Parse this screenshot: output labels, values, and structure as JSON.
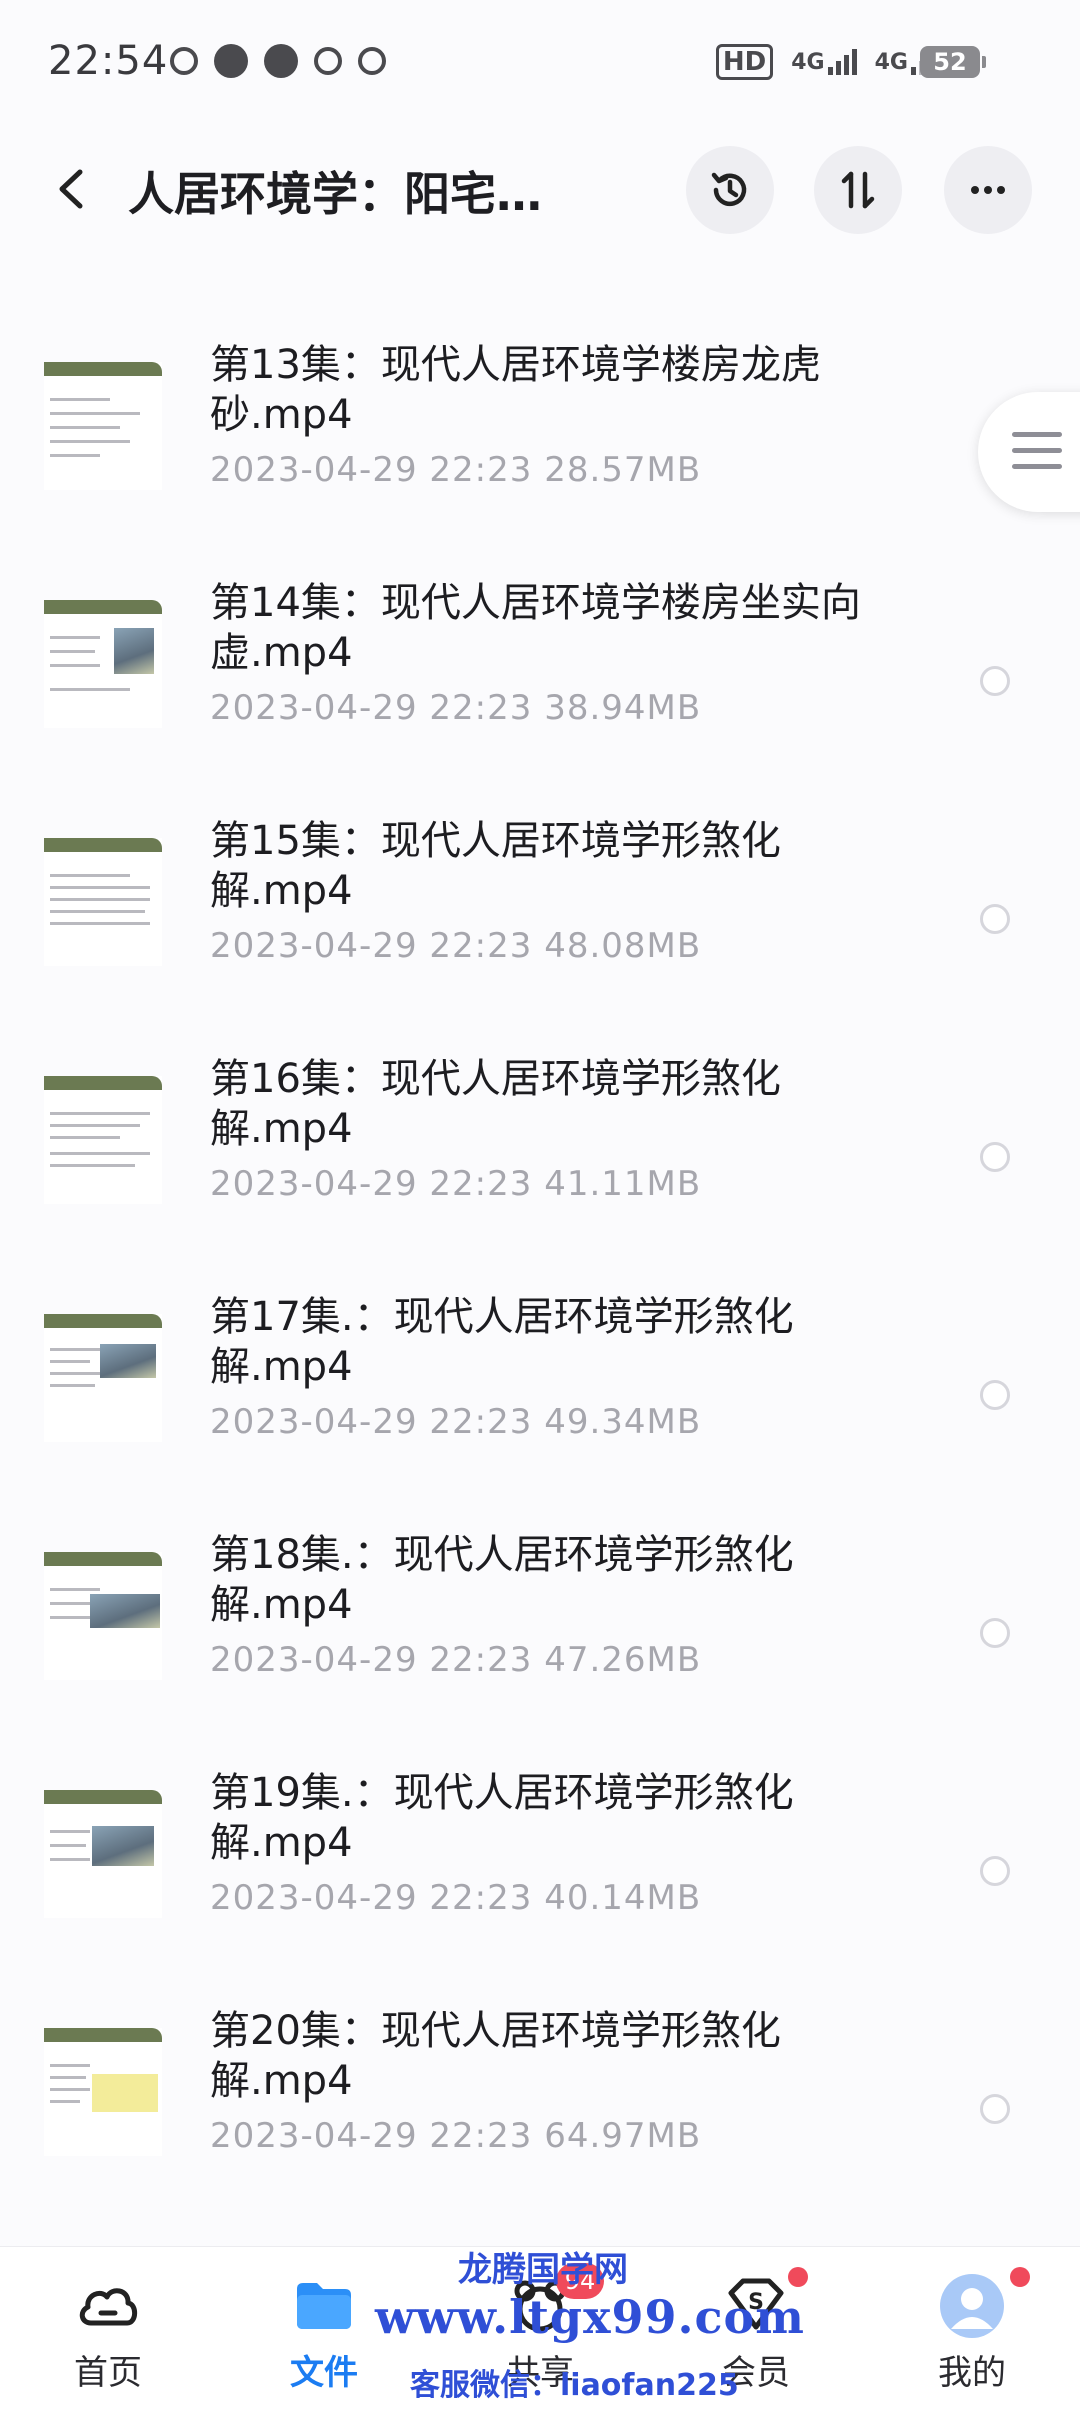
{
  "status_bar": {
    "time": "22:54",
    "hd_label": "HD",
    "net1": "4G",
    "net2": "4G",
    "battery": "52"
  },
  "header": {
    "title": "人居环境学：阳宅…",
    "back_icon": "chevron-left-icon",
    "history_icon": "history-icon",
    "sort_icon": "sort-icon",
    "more_icon": "more-icon"
  },
  "files": [
    {
      "name": "第13集：现代人居环境学楼房龙虎砂.mp4",
      "date": "2023-04-29",
      "time": "22:23",
      "size": "28.57MB"
    },
    {
      "name": "第14集：现代人居环境学楼房坐实向虚.mp4",
      "date": "2023-04-29",
      "time": "22:23",
      "size": "38.94MB"
    },
    {
      "name": "第15集：现代人居环境学形煞化解.mp4",
      "date": "2023-04-29",
      "time": "22:23",
      "size": "48.08MB"
    },
    {
      "name": "第16集：现代人居环境学形煞化解.mp4",
      "date": "2023-04-29",
      "time": "22:23",
      "size": "41.11MB"
    },
    {
      "name": "第17集.：现代人居环境学形煞化解.mp4",
      "date": "2023-04-29",
      "time": "22:23",
      "size": "49.34MB"
    },
    {
      "name": "第18集.：现代人居环境学形煞化解.mp4",
      "date": "2023-04-29",
      "time": "22:23",
      "size": "47.26MB"
    },
    {
      "name": "第19集.：现代人居环境学形煞化解.mp4",
      "date": "2023-04-29",
      "time": "22:23",
      "size": "40.14MB"
    },
    {
      "name": "第20集：现代人居环境学形煞化解.mp4",
      "date": "2023-04-29",
      "time": "22:23",
      "size": "64.97MB"
    }
  ],
  "bottom_nav": {
    "items": [
      {
        "label": "首页",
        "icon": "cloud-icon"
      },
      {
        "label": "文件",
        "icon": "folder-icon"
      },
      {
        "label": "共享",
        "icon": "share-icon",
        "badge": "94"
      },
      {
        "label": "会员",
        "icon": "vip-icon"
      },
      {
        "label": "我的",
        "icon": "avatar-icon"
      }
    ]
  },
  "watermark": {
    "line1": "龙腾国学网",
    "line2": "www.ltgx99.com",
    "line3": "客服微信：liaofan225"
  },
  "colors": {
    "accent": "#1b7cf2",
    "badge": "#f04a5b",
    "watermark": "#2f4fd6"
  }
}
